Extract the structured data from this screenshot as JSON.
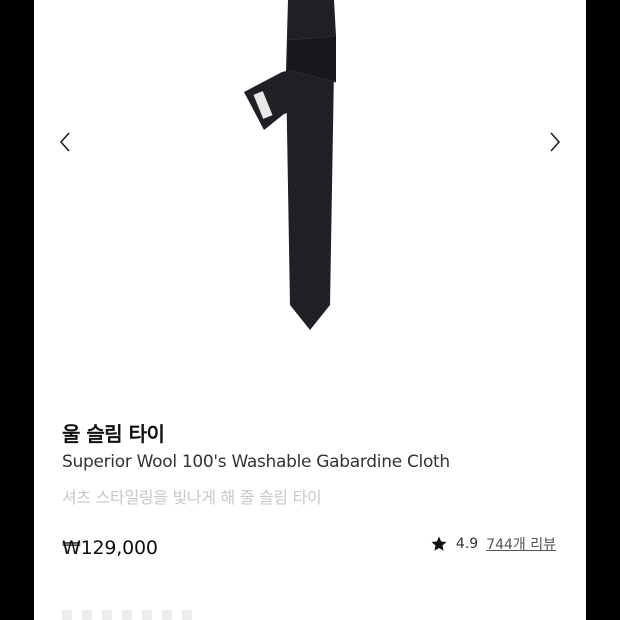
{
  "carousel": {
    "prev_icon": "chevron-left-icon",
    "next_icon": "chevron-right-icon",
    "image_subject": "black slim tie"
  },
  "product": {
    "name_ko": "울 슬림 타이",
    "name_en": "Superior Wool 100's Washable Gabardine Cloth",
    "tagline": "셔츠 스타일링을 빛나게 해 줄 슬림 타이",
    "price": "₩129,000",
    "rating": "4.9",
    "reviews_label": "744개 리뷰",
    "star_icon": "star-icon"
  },
  "colors": {
    "background_outer": "#000000",
    "panel": "#ffffff",
    "tagline": "#c8c8c8",
    "tie": "#1b1d22"
  }
}
